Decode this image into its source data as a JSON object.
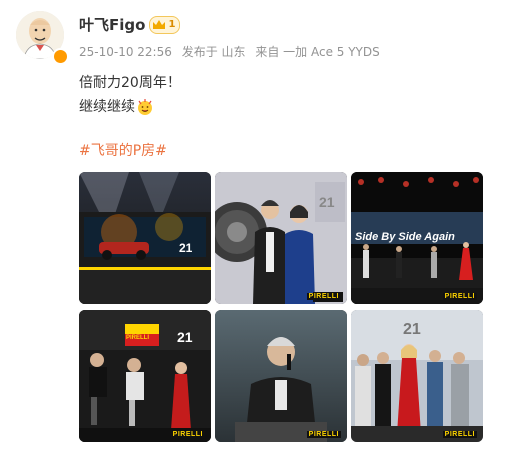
{
  "user": {
    "name": "叶飞Figo",
    "level": "1",
    "avatar_icon": "cartoon-bald-man-avatar",
    "verified_icon": "verified-badge-icon"
  },
  "meta": {
    "time": "25-10-10 22:56",
    "location": "发布于 山东",
    "device": "来自 一加 Ace 5 YYDS"
  },
  "post": {
    "line1": "倍耐力20周年！",
    "line2": "继续继续",
    "emoji": "clapping-face-emoji",
    "hashtag": "#飞哥的P房#"
  },
  "gallery": {
    "watermark": "PIRELLI",
    "photos": [
      {
        "id": "stage-car"
      },
      {
        "id": "couple-portrait"
      },
      {
        "id": "side-by-side-stage",
        "overlay": "Side By Side Again"
      },
      {
        "id": "panel-talk",
        "sign": "PIRELLI"
      },
      {
        "id": "speaker-closeup"
      },
      {
        "id": "group-photo"
      }
    ]
  },
  "colors": {
    "hashtag": "#eb7340",
    "meta": "#939393",
    "brand_yellow": "#ffd500"
  }
}
